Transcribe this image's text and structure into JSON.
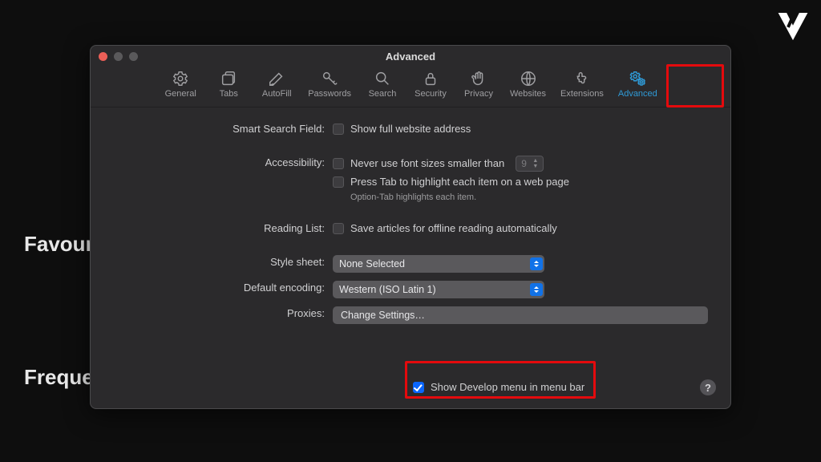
{
  "background": {
    "word1": "Favouri",
    "word2": "Frequer"
  },
  "window": {
    "title": "Advanced",
    "tabs": [
      {
        "key": "general",
        "label": "General"
      },
      {
        "key": "tabs",
        "label": "Tabs"
      },
      {
        "key": "autofill",
        "label": "AutoFill"
      },
      {
        "key": "passwords",
        "label": "Passwords"
      },
      {
        "key": "search",
        "label": "Search"
      },
      {
        "key": "security",
        "label": "Security"
      },
      {
        "key": "privacy",
        "label": "Privacy"
      },
      {
        "key": "websites",
        "label": "Websites"
      },
      {
        "key": "extensions",
        "label": "Extensions"
      },
      {
        "key": "advanced",
        "label": "Advanced"
      }
    ],
    "active_tab": "advanced"
  },
  "settings": {
    "smart_search": {
      "label": "Smart Search Field:",
      "opt1": "Show full website address",
      "opt1_checked": false
    },
    "accessibility": {
      "label": "Accessibility:",
      "opt1": "Never use font sizes smaller than",
      "opt1_checked": false,
      "font_size": "9",
      "opt2": "Press Tab to highlight each item on a web page",
      "opt2_checked": false,
      "note": "Option-Tab highlights each item."
    },
    "reading_list": {
      "label": "Reading List:",
      "opt1": "Save articles for offline reading automatically",
      "opt1_checked": false
    },
    "style_sheet": {
      "label": "Style sheet:",
      "value": "None Selected"
    },
    "default_encoding": {
      "label": "Default encoding:",
      "value": "Western (ISO Latin 1)"
    },
    "proxies": {
      "label": "Proxies:",
      "button": "Change Settings…"
    },
    "develop": {
      "label": "Show Develop menu in menu bar",
      "checked": true
    }
  },
  "help_glyph": "?"
}
